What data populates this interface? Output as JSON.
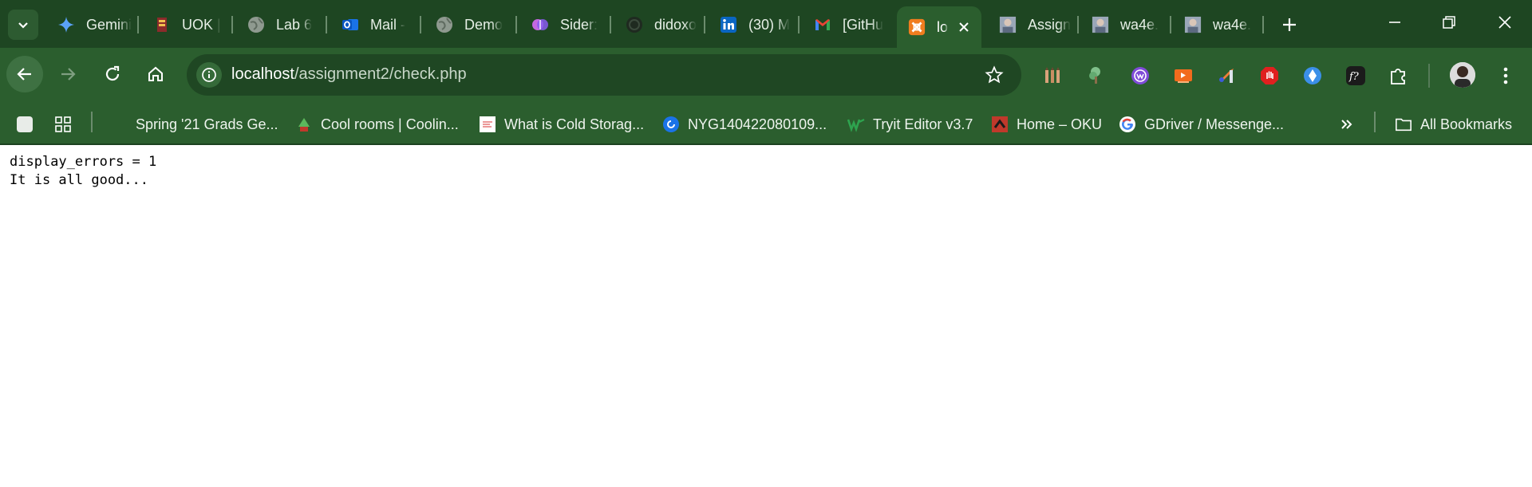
{
  "tabs": [
    {
      "title": "Gemini",
      "icon": "gemini-icon"
    },
    {
      "title": "UOK | ",
      "icon": "uok-icon"
    },
    {
      "title": "Lab 6",
      "icon": "globe-icon"
    },
    {
      "title": "Mail - ",
      "icon": "outlook-icon"
    },
    {
      "title": "Demo",
      "icon": "globe-icon"
    },
    {
      "title": "Sider:",
      "icon": "sider-icon"
    },
    {
      "title": "didoxo",
      "icon": "github-icon"
    },
    {
      "title": "(30) M",
      "icon": "linkedin-icon"
    },
    {
      "title": "[GitHu",
      "icon": "gmail-icon"
    },
    {
      "title": "lo",
      "icon": "xampp-icon",
      "active": true
    },
    {
      "title": "Assign",
      "icon": "thumbnail-icon"
    },
    {
      "title": "wa4e.",
      "icon": "thumbnail-icon"
    },
    {
      "title": "wa4e.",
      "icon": "thumbnail-icon"
    }
  ],
  "address_bar": {
    "host": "localhost",
    "path": "/assignment2/check.php"
  },
  "extensions": {
    "badge_count": "6"
  },
  "bookmarks": [
    {
      "label": "Spring '21 Grads Ge...",
      "icon": "blank-icon"
    },
    {
      "label": "Cool rooms | Coolin...",
      "icon": "coolroom-icon"
    },
    {
      "label": "What is Cold Storag...",
      "icon": "doc-icon"
    },
    {
      "label": "NYG140422080109...",
      "icon": "circle-icon"
    },
    {
      "label": "Tryit Editor v3.7",
      "icon": "w3-icon"
    },
    {
      "label": "Home – OKU",
      "icon": "oku-icon"
    },
    {
      "label": "GDriver / Messenge...",
      "icon": "google-icon"
    }
  ],
  "all_bookmarks_label": "All Bookmarks",
  "page": {
    "line1": "display_errors = 1",
    "line2": "It is all good..."
  },
  "colors": {
    "tabstrip": "#1e4622",
    "toolbar": "#2b5e2e",
    "omnibox": "#1f4723"
  }
}
